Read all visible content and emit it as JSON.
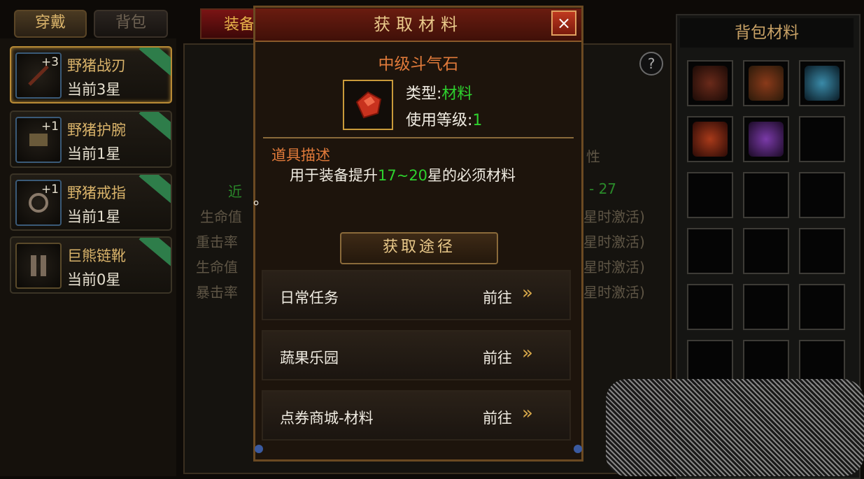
{
  "tabs": {
    "wear": "穿戴",
    "bag": "背包"
  },
  "equipment": [
    {
      "enh": "+3",
      "name": "野猪战刃",
      "stars": "当前3星",
      "selected": true
    },
    {
      "enh": "+1",
      "name": "野猪护腕",
      "stars": "当前1星",
      "selected": false
    },
    {
      "enh": "+1",
      "name": "野猪戒指",
      "stars": "当前1星",
      "selected": false
    },
    {
      "enh": "",
      "name": "巨熊链靴",
      "stars": "当前0星",
      "selected": false
    }
  ],
  "middle": {
    "tab": "装备",
    "help": "?",
    "bg_left": [
      "近",
      "生命值",
      "重击率",
      "生命值",
      "暴击率"
    ],
    "bg_right": [
      "性",
      "- 27",
      "星时激活)",
      "星时激活)",
      "星时激活)",
      "星时激活)"
    ]
  },
  "right_panel": {
    "title": "背包材料"
  },
  "modal": {
    "title": "获取材料",
    "close": "×",
    "item_name": "中级斗气石",
    "type_label": "类型:",
    "type_value": "材料",
    "level_label": "使用等级:",
    "level_value": "1",
    "desc_title": "道具描述",
    "desc_pre": "用于装备提升",
    "desc_range": "17~20",
    "desc_post": "星的必须材料",
    "desc_tail": "。",
    "sources_title": "获取途径",
    "sources": [
      {
        "name": "日常任务",
        "go": "前往"
      },
      {
        "name": "蔬果乐园",
        "go": "前往"
      },
      {
        "name": "点券商城-材料",
        "go": "前往"
      }
    ],
    "arrow_glyph": "»"
  },
  "colors": {
    "accent": "#e07a3a",
    "green": "#2ed12e",
    "gold": "#d9b36a"
  }
}
